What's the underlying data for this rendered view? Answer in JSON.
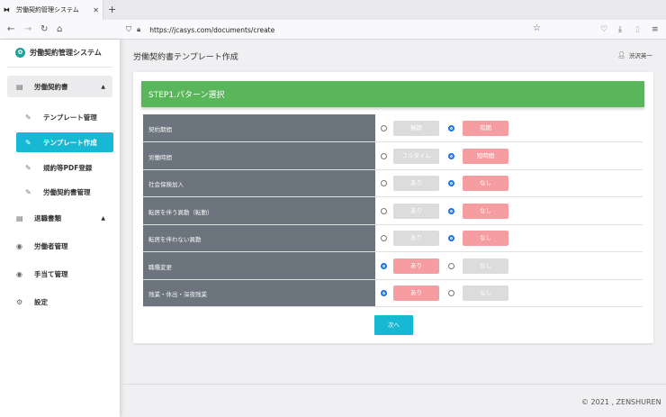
{
  "browser": {
    "tab_title": "労働契約管理システム",
    "tab_close": "✕",
    "new_tab": "+",
    "url": "https://jcasys.com/documents/create"
  },
  "sidebar": {
    "brand": "労働契約管理システム",
    "groups": [
      {
        "label": "労働契約書",
        "icon": "document-icon"
      },
      {
        "label": "退職書類",
        "icon": "document-icon"
      },
      {
        "label": "労働者管理",
        "icon": "user-icon"
      },
      {
        "label": "手当て管理",
        "icon": "user-icon"
      },
      {
        "label": "設定",
        "icon": "gear-icon"
      }
    ],
    "sub_items": [
      {
        "label": "テンプレート管理"
      },
      {
        "label": "テンプレート作成"
      },
      {
        "label": "規約等PDF登録"
      },
      {
        "label": "労働契約書管理"
      }
    ]
  },
  "main": {
    "title": "労働契約書テンプレート作成",
    "user_name": "渋沢英一",
    "step_header": "STEP1.パターン選択",
    "rows": [
      {
        "label": "契約期間",
        "option_a": "無期",
        "option_b": "有期",
        "selected": "b"
      },
      {
        "label": "労働時間",
        "option_a": "フルタイム",
        "option_b": "短時間",
        "selected": "b"
      },
      {
        "label": "社会保険加入",
        "option_a": "あり",
        "option_b": "なし",
        "selected": "b"
      },
      {
        "label": "転居を伴う異動（転勤）",
        "option_a": "あり",
        "option_b": "なし",
        "selected": "b"
      },
      {
        "label": "転居を伴わない異動",
        "option_a": "あり",
        "option_b": "なし",
        "selected": "b"
      },
      {
        "label": "職種変更",
        "option_a": "あり",
        "option_b": "なし",
        "selected": "a"
      },
      {
        "label": "残業・休出・深夜残業",
        "option_a": "あり",
        "option_b": "なし",
        "selected": "a"
      }
    ],
    "next_button": "次へ"
  },
  "footer": "© 2021 , ZENSHUREN",
  "colors": {
    "accent": "#17b8d4",
    "header_green": "#59b65b",
    "selected_chip": "#f59da0",
    "label_block": "#6c757d"
  }
}
